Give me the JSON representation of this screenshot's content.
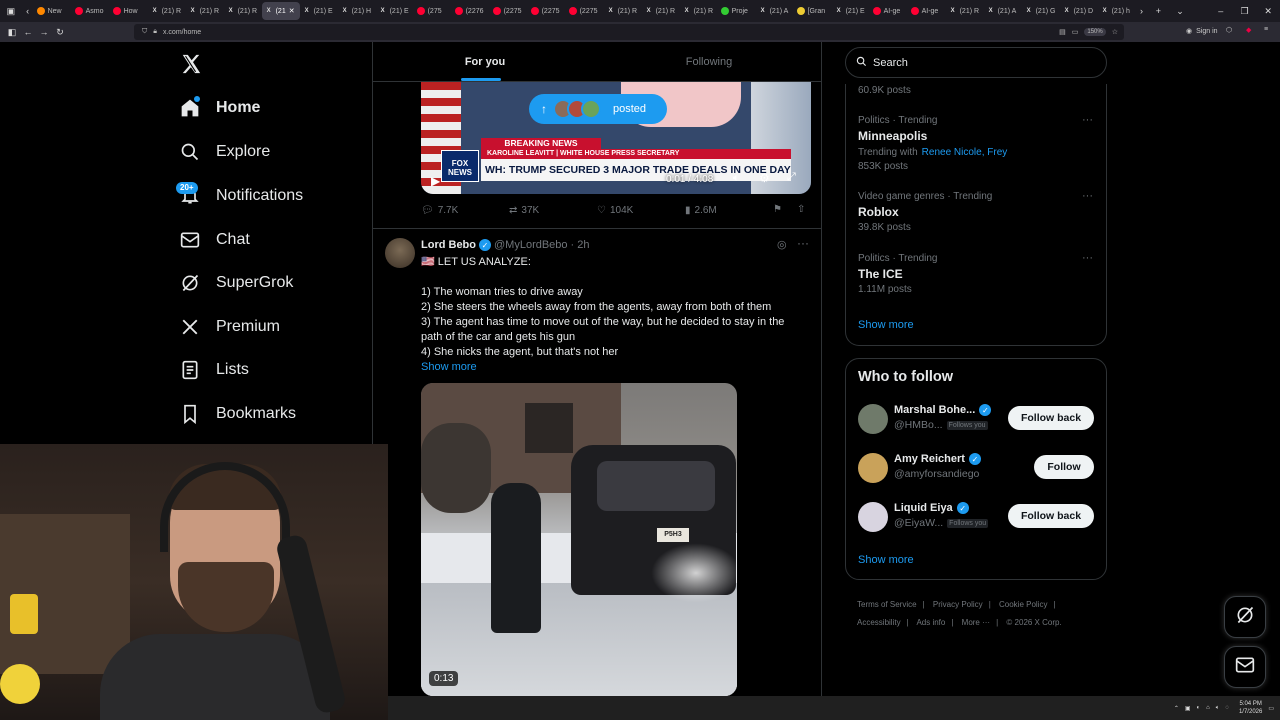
{
  "browser": {
    "tabs": [
      {
        "label": "New",
        "icon": "firefox-icon"
      },
      {
        "label": "Asmo",
        "icon": "youtube-icon"
      },
      {
        "label": "How",
        "icon": "youtube-icon"
      },
      {
        "label": "(21) R",
        "icon": "x-icon"
      },
      {
        "label": "(21) R",
        "icon": "x-icon"
      },
      {
        "label": "(21) R",
        "icon": "x-icon"
      },
      {
        "label": "(21",
        "icon": "x-icon",
        "active": true
      },
      {
        "label": "(21) E",
        "icon": "x-icon"
      },
      {
        "label": "(21) H",
        "icon": "x-icon"
      },
      {
        "label": "(21) E",
        "icon": "x-icon"
      },
      {
        "label": "(275",
        "icon": "youtube-icon"
      },
      {
        "label": "(2276",
        "icon": "youtube-icon"
      },
      {
        "label": "(2275",
        "icon": "youtube-icon"
      },
      {
        "label": "(2275",
        "icon": "youtube-icon"
      },
      {
        "label": "(2275",
        "icon": "youtube-icon"
      },
      {
        "label": "(21) R",
        "icon": "x-icon"
      },
      {
        "label": "(21) R",
        "icon": "x-icon"
      },
      {
        "label": "(21) R",
        "icon": "x-icon"
      },
      {
        "label": "Proje",
        "icon": "leaf-icon"
      },
      {
        "label": "(21) A",
        "icon": "x-icon"
      },
      {
        "label": "[Gran",
        "icon": "shield-icon"
      },
      {
        "label": "(21) E",
        "icon": "x-icon"
      },
      {
        "label": "AI-ge",
        "icon": "youtube-icon"
      },
      {
        "label": "AI-ge",
        "icon": "youtube-icon"
      },
      {
        "label": "(21) R",
        "icon": "x-icon"
      },
      {
        "label": "(21) A",
        "icon": "x-icon"
      },
      {
        "label": "(21) G",
        "icon": "x-icon"
      },
      {
        "label": "(21) D",
        "icon": "x-icon"
      },
      {
        "label": "(21) h",
        "icon": "x-icon"
      }
    ],
    "url": "x.com/home",
    "zoom": "150%",
    "sign_in": "Sign in"
  },
  "nav": {
    "items": [
      {
        "label": "Home",
        "icon": "home-icon"
      },
      {
        "label": "Explore",
        "icon": "search-icon"
      },
      {
        "label": "Notifications",
        "icon": "bell-icon",
        "badge": "20+"
      },
      {
        "label": "Chat",
        "icon": "mail-icon"
      },
      {
        "label": "SuperGrok",
        "icon": "grok-icon"
      },
      {
        "label": "Premium",
        "icon": "x-logo-icon"
      },
      {
        "label": "Lists",
        "icon": "list-icon"
      },
      {
        "label": "Bookmarks",
        "icon": "bookmark-icon"
      }
    ]
  },
  "feed": {
    "tabs": [
      "For you",
      "Following"
    ],
    "posted_pill": "posted",
    "video1": {
      "banner_top": "BREAKING NEWS",
      "banner_name": "KAROLINE LEAVITT | WHITE HOUSE PRESS SECRETARY",
      "headline": "WH: TRUMP SECURED 3 MAJOR TRADE DEALS IN ONE DAY",
      "channel": "FOX NEWS",
      "time": "0:01 / 4:08"
    },
    "post1_actions": {
      "replies": "7.7K",
      "reposts": "37K",
      "likes": "104K",
      "views": "2.6M"
    },
    "post2": {
      "name": "Lord Bebo",
      "handle": "@MyLordBebo",
      "time": "· 2h",
      "lead": "🇺🇸 LET US ANALYZE:",
      "lines": [
        "1) The woman tries to drive away",
        "2) She steers the wheels away from the agents, away from both of them",
        "3) The agent has time to move out of the way, but he decided to stay in the",
        "path of the car and gets his gun",
        "4) She nicks the agent, but that's not her"
      ],
      "show_more": "Show more",
      "video_duration": "0:13",
      "plate": "P5H3"
    }
  },
  "search": {
    "placeholder": "Search"
  },
  "trends": {
    "top_count": "60.9K posts",
    "items": [
      {
        "category": "Politics · Trending",
        "name": "Minneapolis",
        "with_label": "Trending with",
        "with_names": "Renee Nicole, Frey",
        "count": "853K posts"
      },
      {
        "category": "Video game genres · Trending",
        "name": "Roblox",
        "count": "39.8K posts"
      },
      {
        "category": "Politics · Trending",
        "name": "The ICE",
        "count": "1.11M posts"
      }
    ],
    "show_more": "Show more"
  },
  "who_to_follow": {
    "title": "Who to follow",
    "users": [
      {
        "name": "Marshal Bohe...",
        "handle": "@HMBo...",
        "follows_you": "Follows you",
        "button": "Follow back",
        "avatar_color": "#6f7a6a"
      },
      {
        "name": "Amy Reichert",
        "handle": "@amyforsandiego",
        "follows_you": "",
        "button": "Follow",
        "avatar_color": "#c9a25a"
      },
      {
        "name": "Liquid Eiya",
        "handle": "@EiyaW...",
        "follows_you": "Follows you",
        "button": "Follow back",
        "avatar_color": "#d8d4e0"
      }
    ],
    "show_more": "Show more"
  },
  "footer": {
    "links": [
      "Terms of Service",
      "Privacy Policy",
      "Cookie Policy",
      "Accessibility",
      "Ads info",
      "More ···",
      "© 2026 X Corp."
    ]
  },
  "taskbar": {
    "time": "5:04 PM",
    "date": "1/7/2026"
  }
}
